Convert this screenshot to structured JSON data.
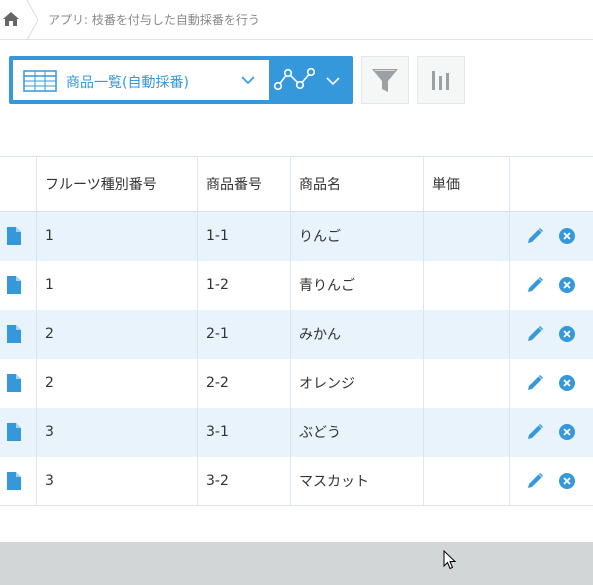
{
  "breadcrumb": {
    "home_icon": "home-icon",
    "text": "アプリ: 枝番を付与した自動採番を行う"
  },
  "toolbar": {
    "view_icon": "table-view-icon",
    "view_name": "商品一覧(自動採番)",
    "graph_icon": "line-graph-icon",
    "filter_icon": "filter-icon",
    "stats_icon": "bar-chart-icon"
  },
  "table": {
    "columns": [
      "フルーツ種別番号",
      "商品番号",
      "商品名",
      "単価"
    ],
    "rows": [
      {
        "fruit_type": "1",
        "product_no": "1-1",
        "product_name": "りんご",
        "price": ""
      },
      {
        "fruit_type": "1",
        "product_no": "1-2",
        "product_name": "青りんご",
        "price": ""
      },
      {
        "fruit_type": "2",
        "product_no": "2-1",
        "product_name": "みかん",
        "price": ""
      },
      {
        "fruit_type": "2",
        "product_no": "2-2",
        "product_name": "オレンジ",
        "price": ""
      },
      {
        "fruit_type": "3",
        "product_no": "3-1",
        "product_name": "ぶどう",
        "price": ""
      },
      {
        "fruit_type": "3",
        "product_no": "3-2",
        "product_name": "マスカット",
        "price": ""
      }
    ]
  },
  "colors": {
    "accent": "#3498db",
    "row_stripe": "#e8f3fc",
    "footer": "#d3d6d7"
  }
}
